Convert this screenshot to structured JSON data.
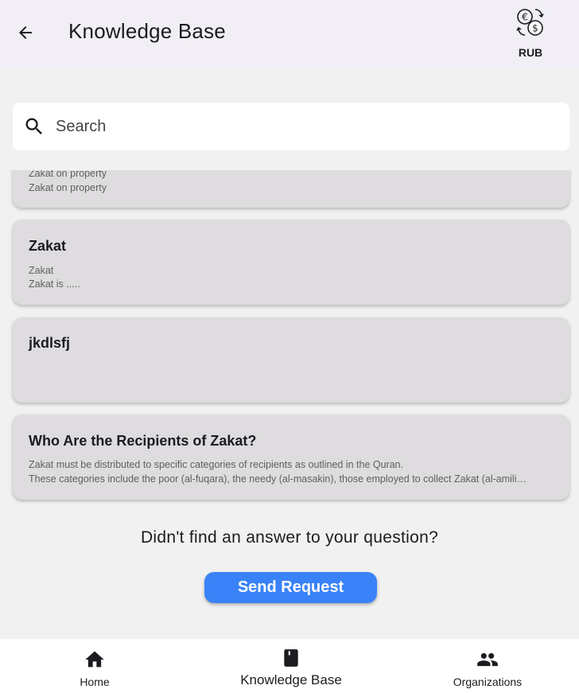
{
  "header": {
    "title": "Knowledge Base",
    "currency": "RUB"
  },
  "search": {
    "placeholder": "Search",
    "value": ""
  },
  "articles": [
    {
      "title": "",
      "lines": [
        "Zakat on property",
        "Zakat on property"
      ]
    },
    {
      "title": "Zakat",
      "lines": [
        "Zakat",
        "Zakat is ....."
      ]
    },
    {
      "title": "jkdlsfj",
      "lines": []
    },
    {
      "title": "Who Are the Recipients of Zakat?",
      "lines": [
        "Zakat must be distributed to specific categories of recipients as outlined in the Quran.",
        "These categories include the poor (al-fuqara), the needy (al-masakin), those employed to collect Zakat (al-amili…"
      ]
    }
  ],
  "footer_prompt": {
    "question": "Didn't find an answer to your question?",
    "button": "Send Request"
  },
  "bottom_nav": {
    "items": [
      {
        "label": "Home",
        "icon": "home-icon"
      },
      {
        "label": "Knowledge Base",
        "icon": "book-icon"
      },
      {
        "label": "Organizations",
        "icon": "people-icon"
      }
    ],
    "selected": "Knowledge Base"
  },
  "colors": {
    "accent": "#3a82f7",
    "card": "#dedcde",
    "appbar": "#f1eff5",
    "background": "#f1f1f1"
  }
}
